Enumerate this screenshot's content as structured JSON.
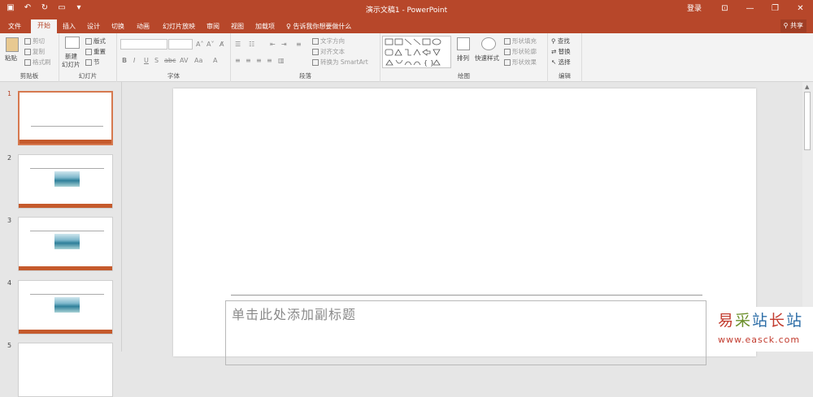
{
  "titlebar": {
    "document_title": "演示文稿1  -  PowerPoint",
    "login": "登录",
    "window_buttons": [
      "⊡",
      "—",
      "❐",
      "✕"
    ]
  },
  "tabs": [
    "文件",
    "开始",
    "插入",
    "设计",
    "切换",
    "动画",
    "幻灯片放映",
    "审阅",
    "视图",
    "加载项"
  ],
  "tell_me": "告诉我你想要做什么",
  "share": "共享",
  "ribbon": {
    "clipboard": {
      "paste": "粘贴",
      "cut": "剪切",
      "copy": "复制",
      "format_painter": "格式刷",
      "label": "剪贴板"
    },
    "slides": {
      "new_slide_1": "新建",
      "new_slide_2": "幻灯片",
      "layout": "版式",
      "reset": "重置",
      "section": "节",
      "label": "幻灯片"
    },
    "font": {
      "label": "字体",
      "buttons": [
        "B",
        "I",
        "U",
        "S",
        "abc",
        "AV",
        "Aa",
        "A"
      ]
    },
    "paragraph": {
      "text_direction": "文字方向",
      "align_text": "对齐文本",
      "smartart": "转换为 SmartArt",
      "label": "段落"
    },
    "drawing": {
      "arrange": "排列",
      "quick_styles": "快速样式",
      "shape_fill": "形状填充",
      "shape_outline": "形状轮廓",
      "shape_effects": "形状效果",
      "label": "绘图"
    },
    "editing": {
      "find": "查找",
      "replace": "替换",
      "select": "选择",
      "label": "编辑"
    }
  },
  "slides": [
    {
      "number": "1"
    },
    {
      "number": "2"
    },
    {
      "number": "3"
    },
    {
      "number": "4"
    },
    {
      "number": "5"
    }
  ],
  "slide_canvas": {
    "subtitle_placeholder": "单击此处添加副标题"
  },
  "watermark": {
    "title": "易采站长站",
    "url": "www.easck.com"
  },
  "colors": {
    "accent": "#b7472a",
    "thumb_bar": "#c55a2c"
  }
}
